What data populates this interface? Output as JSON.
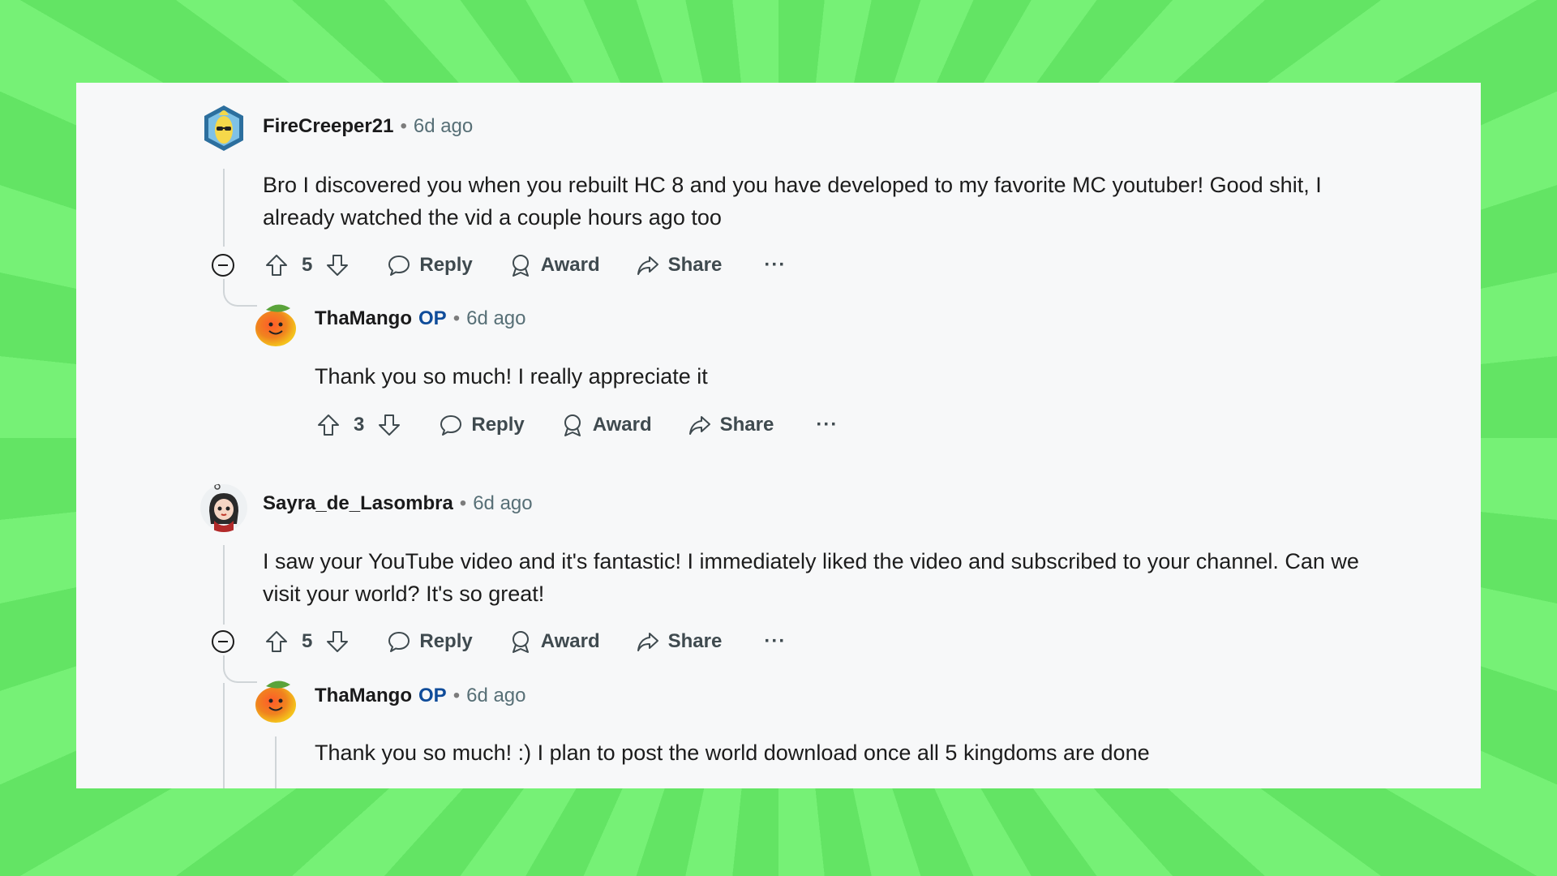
{
  "comments": [
    {
      "username": "FireCreeper21",
      "time": "6d ago",
      "text": "Bro I discovered you when you rebuilt HC 8 and you have developed to my favorite MC youtuber! Good shit, I already watched the vid a couple hours ago too",
      "votes": "5",
      "avatar_icon": "banana-character-avatar",
      "reply": {
        "username": "ThaMango",
        "flair": "OP",
        "time": "6d ago",
        "text": "Thank you so much! I really appreciate it",
        "votes": "3",
        "avatar_icon": "mango-avatar"
      }
    },
    {
      "username": "Sayra_de_Lasombra",
      "time": "6d ago",
      "text": "I saw your YouTube video and it's fantastic! I immediately liked the video and subscribed to your channel. Can we visit your world? It's so great!",
      "votes": "5",
      "avatar_icon": "girl-character-avatar",
      "reply": {
        "username": "ThaMango",
        "flair": "OP",
        "time": "6d ago",
        "text": "Thank you so much! :) I plan to post the world download once all 5 kingdoms are done",
        "avatar_icon": "mango-avatar"
      }
    }
  ],
  "actions": {
    "reply": "Reply",
    "award": "Award",
    "share": "Share",
    "more": "···"
  },
  "colors": {
    "background": "#6cea6c",
    "panel": "#f7f8f9",
    "op_flair": "#0f4c9a",
    "meta": "#576f76"
  }
}
